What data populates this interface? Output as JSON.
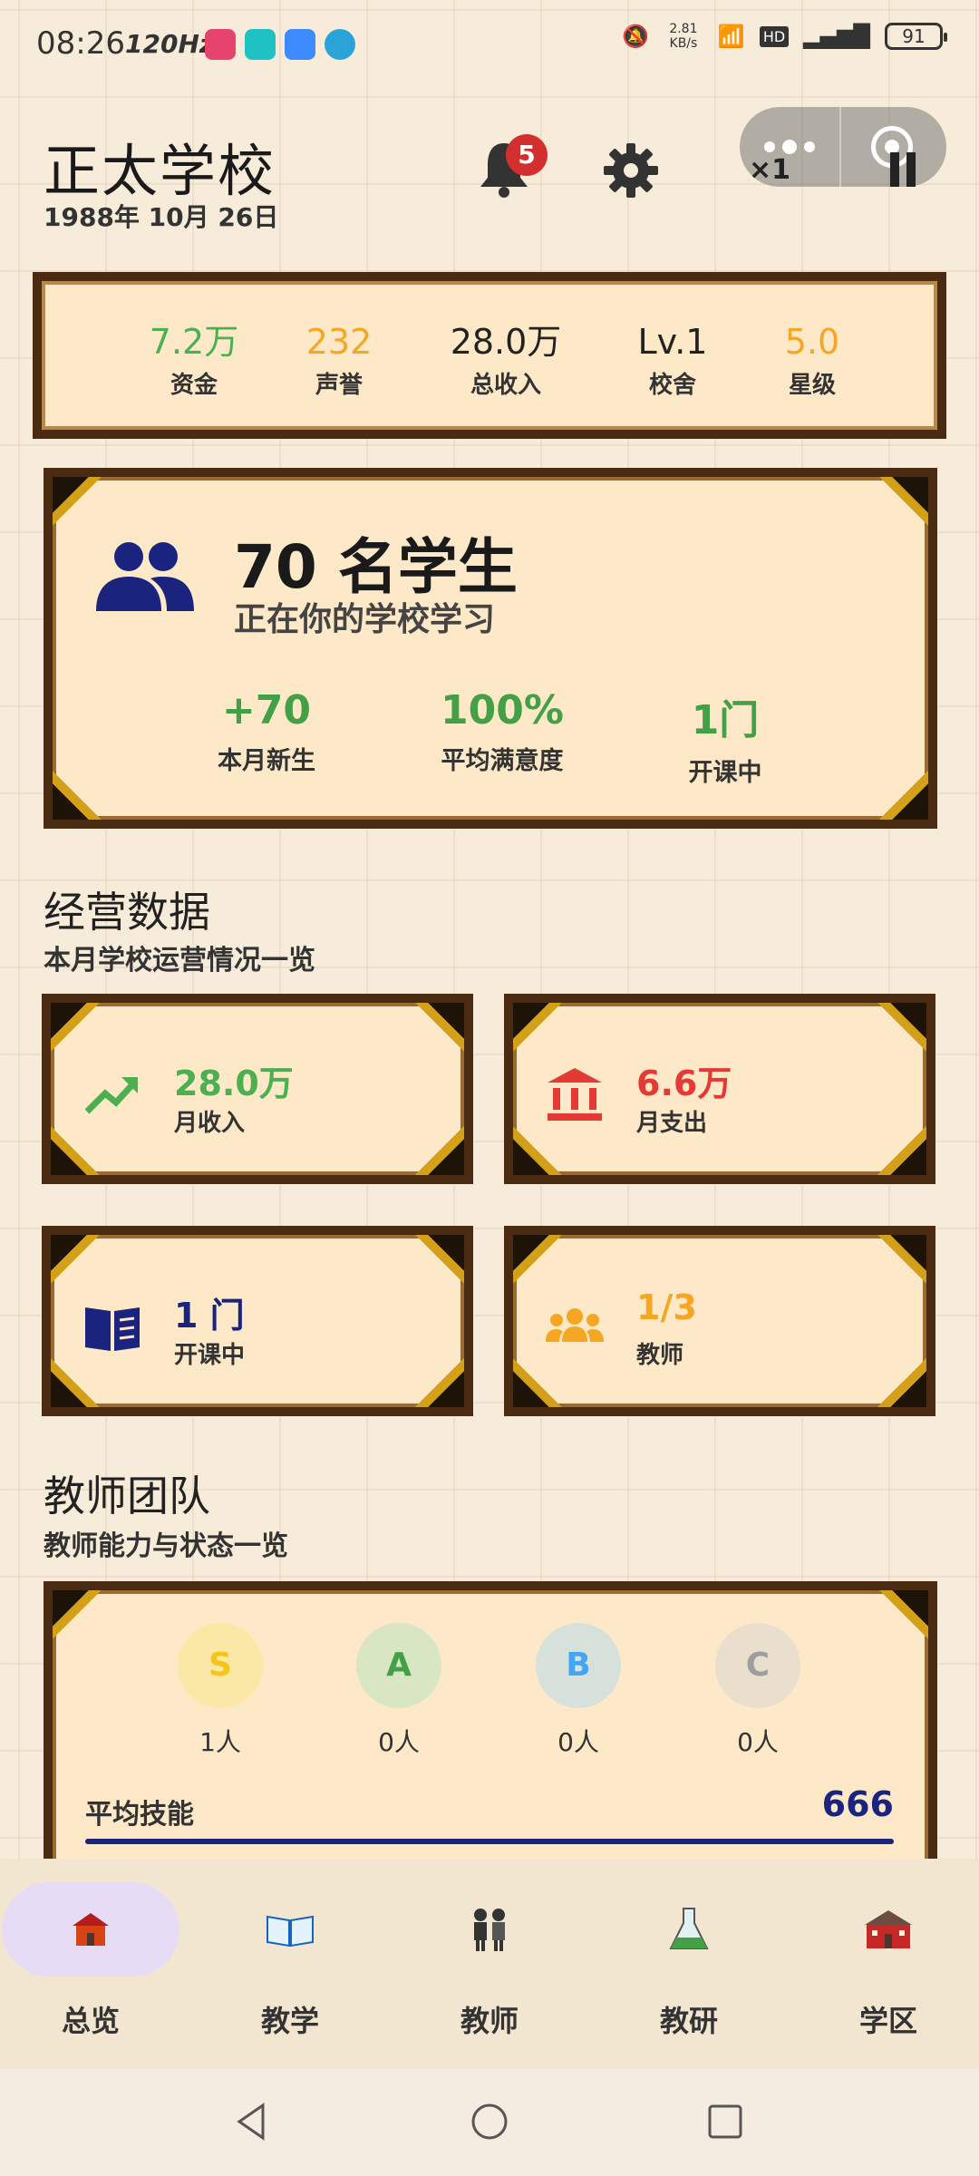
{
  "status_bar": {
    "time": "08:26",
    "refresh_rate": "120Hz",
    "net_speed": "2.81 KB/s",
    "battery": "91"
  },
  "header": {
    "school_name": "正太学校",
    "date": "1988年 10月 26日",
    "notification_count": "5",
    "speed": "×1"
  },
  "stats": [
    {
      "value": "7.2万",
      "label": "资金",
      "color": "#4caf50"
    },
    {
      "value": "232",
      "label": "声誉",
      "color": "#f5a623"
    },
    {
      "value": "28.0万",
      "label": "总收入",
      "color": "#222222"
    },
    {
      "value": "Lv.1",
      "label": "校舍",
      "color": "#222222"
    },
    {
      "value": "5.0",
      "label": "星级",
      "color": "#f5a623"
    }
  ],
  "students": {
    "count": "70 名学生",
    "subtitle": "正在你的学校学习",
    "metrics": [
      {
        "value": "+70",
        "label": "本月新生"
      },
      {
        "value": "100%",
        "label": "平均满意度"
      },
      {
        "value": "1门",
        "label": "开课中"
      }
    ]
  },
  "operations": {
    "title": "经营数据",
    "subtitle": "本月学校运营情况一览",
    "cards": [
      {
        "value": "28.0万",
        "label": "月收入",
        "icon": "trending-up-icon",
        "color": "#4caf50"
      },
      {
        "value": "6.6万",
        "label": "月支出",
        "icon": "bank-icon",
        "color": "#e53935"
      },
      {
        "value": "1 门",
        "label": "开课中",
        "icon": "book-icon",
        "color": "#1a237e"
      },
      {
        "value": "1/3",
        "label": "教师",
        "icon": "group-icon",
        "color": "#f5a623"
      }
    ]
  },
  "teachers": {
    "title": "教师团队",
    "subtitle": "教师能力与状态一览",
    "grades": [
      {
        "letter": "S",
        "count": "1人",
        "bg": "#fbe7a6",
        "fg": "#f5c518"
      },
      {
        "letter": "A",
        "count": "0人",
        "bg": "#d9e6c4",
        "fg": "#43a047"
      },
      {
        "letter": "B",
        "count": "0人",
        "bg": "#d6e1dc",
        "fg": "#42a5f5"
      },
      {
        "letter": "C",
        "count": "0人",
        "bg": "#e9dfcc",
        "fg": "#9e9e9e"
      }
    ],
    "avg_skill_label": "平均技能",
    "avg_skill_value": "666"
  },
  "nav": [
    {
      "label": "总览",
      "icon": "school-house-icon",
      "active": true
    },
    {
      "label": "教学",
      "icon": "open-book-icon",
      "active": false
    },
    {
      "label": "教师",
      "icon": "teachers-icon",
      "active": false
    },
    {
      "label": "教研",
      "icon": "flask-icon",
      "active": false
    },
    {
      "label": "学区",
      "icon": "campus-icon",
      "active": false
    }
  ]
}
